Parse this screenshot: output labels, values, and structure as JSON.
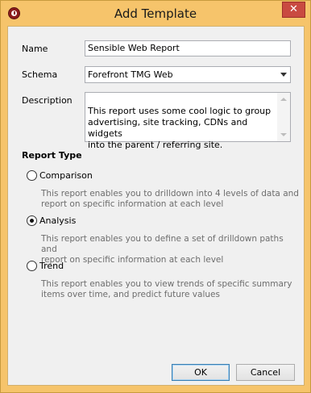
{
  "window": {
    "title": "Add Template",
    "close_label": "✕"
  },
  "form": {
    "name_label": "Name",
    "name_value": "Sensible Web Report",
    "schema_label": "Schema",
    "schema_value": "Forefront TMG Web",
    "description_label": "Description",
    "description_value": "This report uses some cool logic to group\nadvertising, site tracking, CDNs and widgets\ninto the parent / referring site."
  },
  "report_type": {
    "heading": "Report Type",
    "options": [
      {
        "label": "Comparison",
        "selected": false,
        "description": "This report enables you to drilldown into 4 levels of data and\nreport on specific information at each level"
      },
      {
        "label": "Analysis",
        "selected": true,
        "description": "This report enables you to define a set of drilldown paths and\nreport on specific information at each level"
      },
      {
        "label": "Trend",
        "selected": false,
        "description": "This report enables you to view trends of specific summary\nitems over time, and predict future values"
      }
    ]
  },
  "buttons": {
    "ok": "OK",
    "cancel": "Cancel"
  }
}
